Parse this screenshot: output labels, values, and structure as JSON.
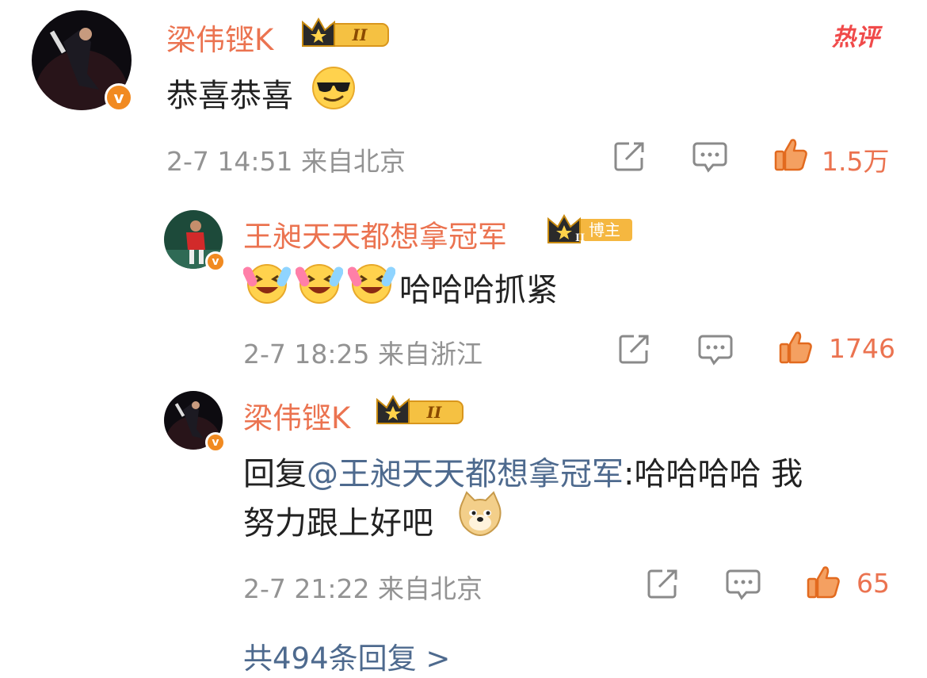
{
  "hot_badge": "热评",
  "comment": {
    "user": "梁伟铿K",
    "text": "恭喜恭喜",
    "time": "2-7 14:51",
    "location": "来自北京",
    "likes": "1.5万",
    "level": "II"
  },
  "replies": [
    {
      "user": "王昶天天都想拿冠军",
      "tag": "博主",
      "level": "II",
      "text": "哈哈哈抓紧",
      "time": "2-7 18:25",
      "location": "来自浙江",
      "likes": "1746"
    },
    {
      "user": "梁伟铿K",
      "level": "II",
      "reply_prefix": "回复",
      "mention": "@王昶天天都想拿冠军",
      "text_line1": ":哈哈哈哈 我",
      "text_line2": "努力跟上好吧",
      "time": "2-7 21:22",
      "location": "来自北京",
      "likes": "65"
    }
  ],
  "more_replies": "共494条回复 >",
  "colors": {
    "username": "#eb7350",
    "meta": "#939393",
    "mention": "#4e6a8e",
    "badge_orange": "#f18a21"
  }
}
